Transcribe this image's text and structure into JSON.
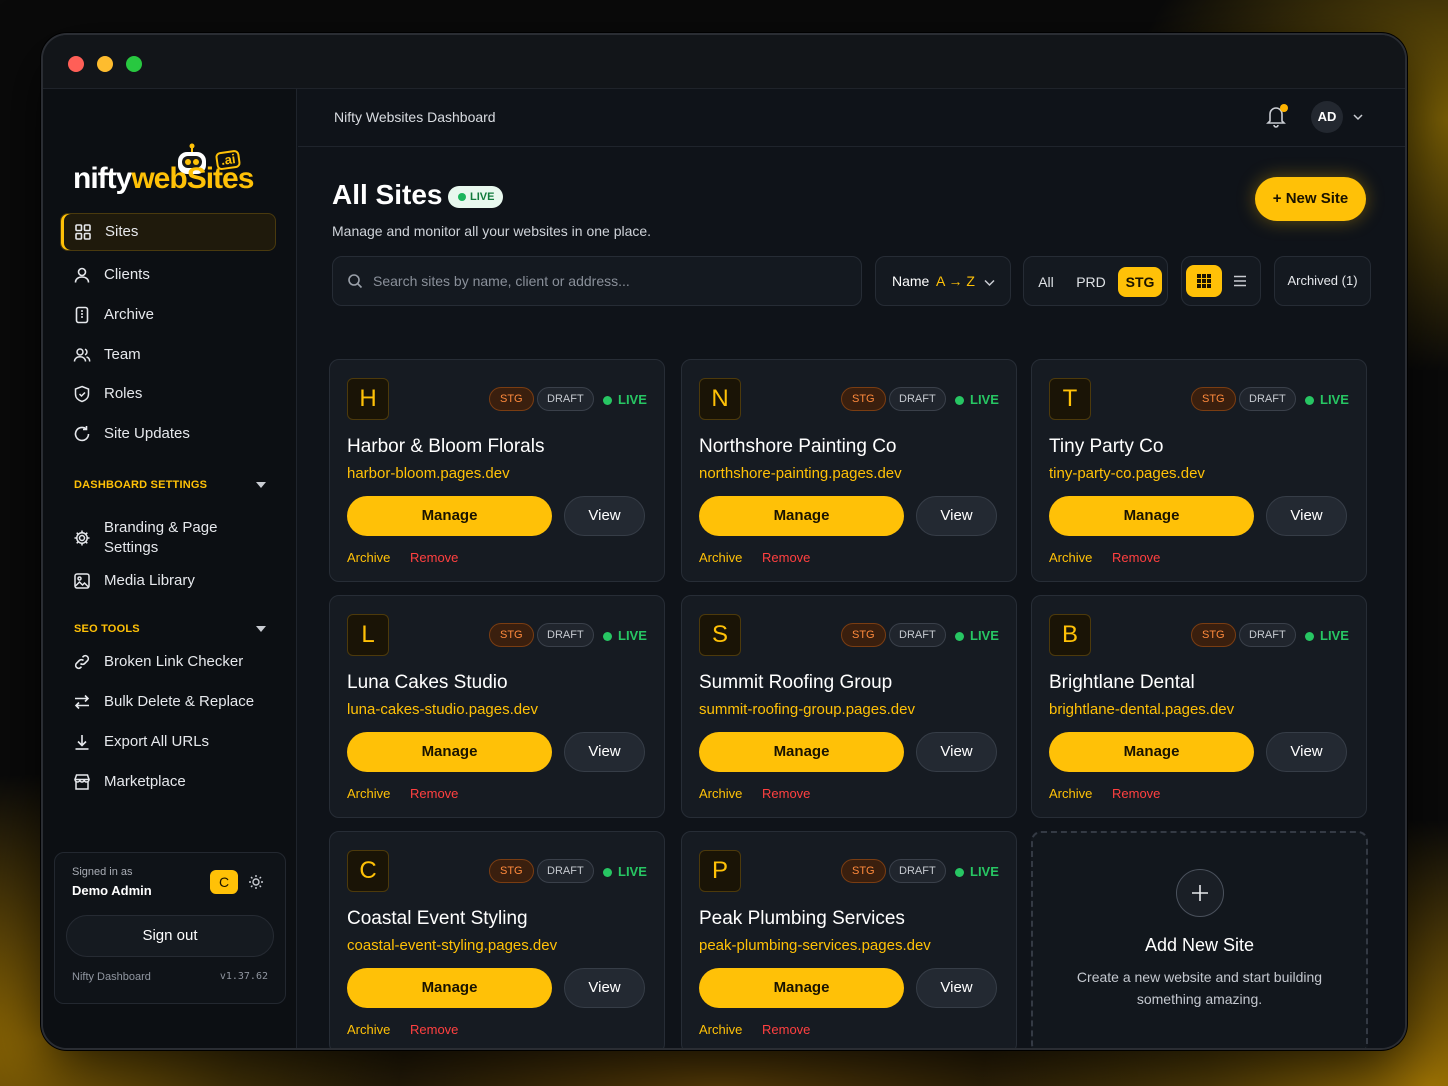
{
  "brand": {
    "logo_prefix": "nifty",
    "logo_web": "web",
    "logo_s": "S",
    "logo_suffix": "ites",
    "logo_badge": ".ai"
  },
  "sidebar": {
    "items": [
      {
        "label": "Sites",
        "icon": "grid-icon",
        "active": true
      },
      {
        "label": "Clients",
        "icon": "user-icon"
      },
      {
        "label": "Archive",
        "icon": "archive-icon"
      },
      {
        "label": "Team",
        "icon": "team-icon"
      },
      {
        "label": "Roles",
        "icon": "shield-icon"
      },
      {
        "label": "Site Updates",
        "icon": "refresh-icon"
      }
    ],
    "dashboard_settings": {
      "title": "DASHBOARD SETTINGS",
      "items": [
        {
          "label": "Branding & Page Settings",
          "icon": "gear-icon"
        },
        {
          "label": "Media Library",
          "icon": "image-icon"
        }
      ]
    },
    "seo_tools": {
      "title": "SEO TOOLS",
      "items": [
        {
          "label": "Broken Link Checker",
          "icon": "link-icon"
        },
        {
          "label": "Bulk Delete & Replace",
          "icon": "swap-icon"
        },
        {
          "label": "Export All URLs",
          "icon": "download-icon"
        },
        {
          "label": "Marketplace",
          "icon": "store-icon"
        }
      ]
    },
    "user": {
      "signed_in_label": "Signed in as",
      "name": "Demo Admin",
      "theme_letter": "C",
      "sign_out": "Sign out",
      "footer_name": "Nifty Dashboard",
      "version": "v1.37.62"
    }
  },
  "topbar": {
    "breadcrumb": "Nifty Websites Dashboard",
    "avatar": "AD"
  },
  "main": {
    "title": "All Sites",
    "live_badge": "LIVE",
    "subtitle": "Manage and monitor all your websites in one place.",
    "new_site": "+ New Site",
    "search_placeholder": "Search sites by name, client or address...",
    "sort_label": "Name",
    "sort_value": "A → Z",
    "env_filters": [
      "All",
      "PRD",
      "STG"
    ],
    "env_selected": "STG",
    "archived": "Archived (1)"
  },
  "cards": [
    {
      "letter": "H",
      "name": "Harbor & Bloom Florals",
      "url": "harbor-bloom.pages.dev"
    },
    {
      "letter": "N",
      "name": "Northshore Painting Co",
      "url": "northshore-painting.pages.dev"
    },
    {
      "letter": "T",
      "name": "Tiny Party Co",
      "url": "tiny-party-co.pages.dev"
    },
    {
      "letter": "L",
      "name": "Luna Cakes Studio",
      "url": "luna-cakes-studio.pages.dev"
    },
    {
      "letter": "S",
      "name": "Summit Roofing Group",
      "url": "summit-roofing-group.pages.dev"
    },
    {
      "letter": "B",
      "name": "Brightlane Dental",
      "url": "brightlane-dental.pages.dev"
    },
    {
      "letter": "C",
      "name": "Coastal Event Styling",
      "url": "coastal-event-styling.pages.dev"
    },
    {
      "letter": "P",
      "name": "Peak Plumbing Services",
      "url": "peak-plumbing-services.pages.dev"
    }
  ],
  "card_labels": {
    "stg": "STG",
    "draft": "DRAFT",
    "live": "LIVE",
    "manage": "Manage",
    "view": "View",
    "archive": "Archive",
    "remove": "Remove"
  },
  "add_card": {
    "title": "Add New Site",
    "desc": "Create a new website and start building something amazing."
  },
  "colors": {
    "accent": "#ffc107",
    "live": "#27c663",
    "remove": "#ff4040",
    "stg": "#ff8a3c"
  }
}
